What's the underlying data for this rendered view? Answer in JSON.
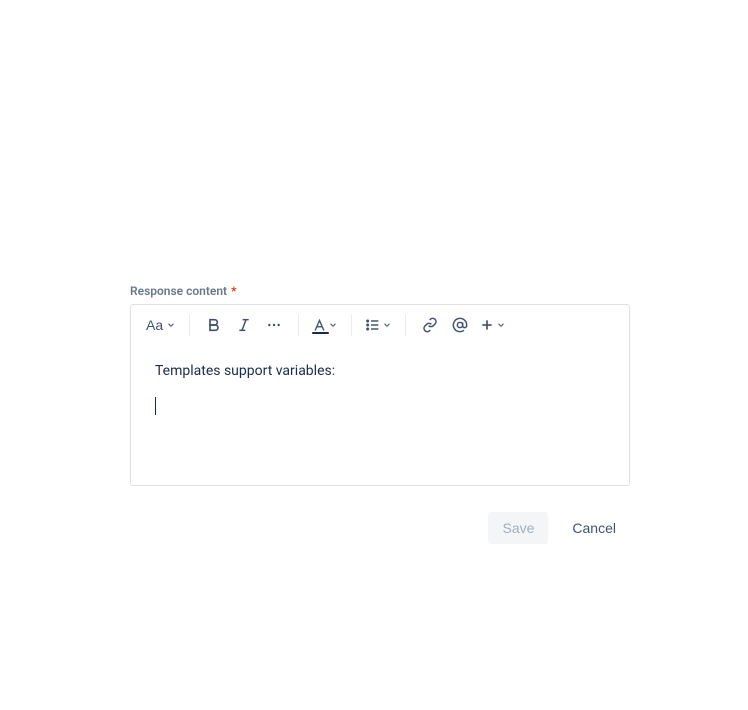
{
  "field": {
    "label": "Response content",
    "required_marker": "*"
  },
  "toolbar": {
    "text_style_label": "Aa"
  },
  "editor": {
    "line1": "Templates support variables:"
  },
  "buttons": {
    "save": "Save",
    "cancel": "Cancel"
  }
}
